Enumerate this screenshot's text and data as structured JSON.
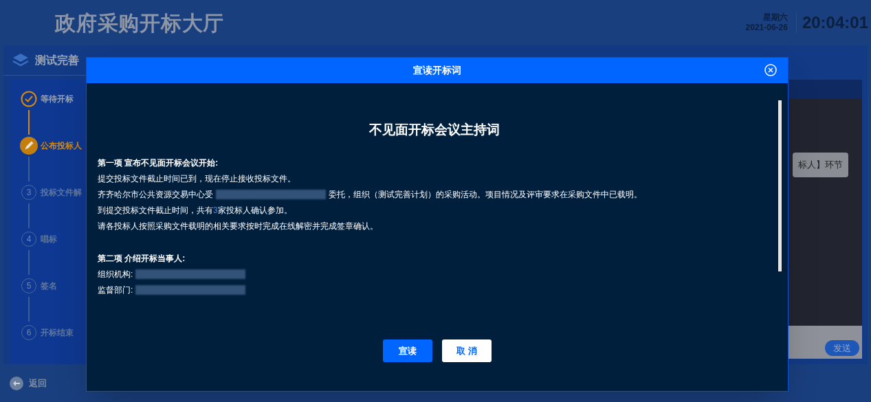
{
  "header": {
    "title": "政府采购开标大厅",
    "weekday": "星期六",
    "date": "2021-06-26",
    "clock": "20:04:01"
  },
  "project": {
    "title": "测试完善"
  },
  "steps": [
    {
      "label": "等待开标",
      "completed": true,
      "active": false
    },
    {
      "label": "公布投标人",
      "completed": false,
      "active": true
    },
    {
      "number": "3",
      "label": "投标文件解",
      "completed": false,
      "active": false
    },
    {
      "number": "4",
      "label": "唱标",
      "completed": false,
      "active": false
    },
    {
      "number": "5",
      "label": "签名",
      "completed": false,
      "active": false
    },
    {
      "number": "6",
      "label": "开标结束",
      "completed": false,
      "active": false
    }
  ],
  "messages": {
    "bubble": "标人】环节",
    "send": "发送"
  },
  "back": "返回",
  "dialog": {
    "title": "宣读开标词",
    "heading": "不见面开标会议主持词",
    "lines": [
      {
        "kind": "section",
        "parts": [
          {
            "kind": "text",
            "text": "第一项 宣布不见面开标会议开始:"
          }
        ]
      },
      {
        "kind": "line",
        "parts": [
          {
            "kind": "text",
            "text": "提交投标文件截止时间已到，现在停止接收投标文件。"
          }
        ]
      },
      {
        "kind": "line",
        "parts": [
          {
            "kind": "text",
            "text": "齐齐哈尔市公共资源交易中心受"
          },
          {
            "kind": "redacted"
          },
          {
            "kind": "text",
            "text": "委托，组织（测试完善计划）的采购活动。项目情况及评审要求在采购文件中已载明。"
          }
        ]
      },
      {
        "kind": "line",
        "parts": [
          {
            "kind": "text",
            "text": "到提交投标文件截止时间，共有"
          },
          {
            "kind": "number",
            "text": "3"
          },
          {
            "kind": "text",
            "text": "家投标人确认参加。"
          }
        ]
      },
      {
        "kind": "line",
        "parts": [
          {
            "kind": "text",
            "text": "请各投标人按照采购文件载明的相关要求按时完成在线解密并完成签章确认。"
          }
        ]
      },
      {
        "kind": "gap"
      },
      {
        "kind": "section",
        "parts": [
          {
            "kind": "text",
            "text": "第二项 介绍开标当事人:"
          }
        ]
      },
      {
        "kind": "line",
        "parts": [
          {
            "kind": "text",
            "text": "组织机构:"
          },
          {
            "kind": "redacted"
          }
        ]
      },
      {
        "kind": "line",
        "parts": [
          {
            "kind": "text",
            "text": "监督部门:"
          },
          {
            "kind": "redacted"
          }
        ]
      }
    ],
    "buttons": [
      {
        "label": "宣读",
        "kind": "primary"
      },
      {
        "label": "取 消",
        "kind": "secondary"
      }
    ]
  }
}
